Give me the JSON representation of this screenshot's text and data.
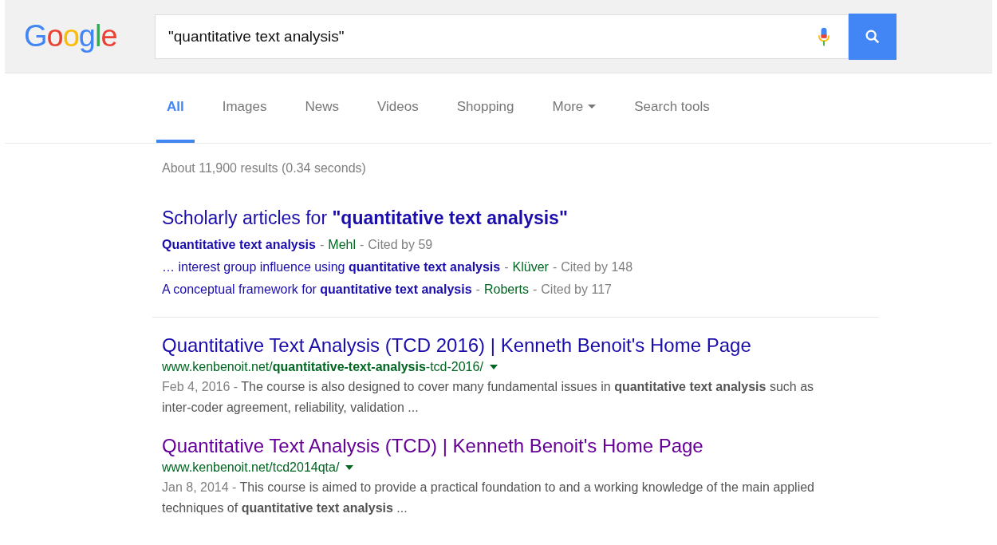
{
  "logo": [
    {
      "char": "G",
      "color": "#4285f4"
    },
    {
      "char": "o",
      "color": "#ea4335"
    },
    {
      "char": "o",
      "color": "#fbbc05"
    },
    {
      "char": "g",
      "color": "#4285f4"
    },
    {
      "char": "l",
      "color": "#34a853"
    },
    {
      "char": "e",
      "color": "#ea4335"
    }
  ],
  "search": {
    "value": "\"quantitative text analysis\""
  },
  "tabs": [
    {
      "label": "All",
      "selected": true,
      "dropdown": false
    },
    {
      "label": "Images",
      "selected": false,
      "dropdown": false
    },
    {
      "label": "News",
      "selected": false,
      "dropdown": false
    },
    {
      "label": "Videos",
      "selected": false,
      "dropdown": false
    },
    {
      "label": "Shopping",
      "selected": false,
      "dropdown": false
    },
    {
      "label": "More",
      "selected": false,
      "dropdown": true
    },
    {
      "label": "Search tools",
      "selected": false,
      "dropdown": false
    }
  ],
  "result_stats": "About 11,900 results (0.34 seconds)",
  "scholarly": {
    "heading": "Scholarly articles for **\"quantitative text analysis\"**",
    "items": [
      {
        "title": "**Quantitative text analysis**",
        "separators": [
          "-",
          "-"
        ],
        "author": "Mehl",
        "cited": "Cited by 59"
      },
      {
        "title": "… interest group influence using **quantitative text analysis**",
        "separators": [
          "-",
          "-"
        ],
        "author": "Klüver",
        "cited": "Cited by 148"
      },
      {
        "title": "A conceptual framework for **quantitative text analysis**",
        "separators": [
          "-",
          "-"
        ],
        "author": "Roberts",
        "cited": "Cited by 117"
      }
    ]
  },
  "results": [
    {
      "title": "Quantitative Text Analysis (TCD 2016) | Kenneth Benoit's Home Page",
      "visited": false,
      "url": "www.kenbenoit.net/**quantitative-text-analysis**-tcd-2016/",
      "date": "Feb 4, 2016 -",
      "snippet": "The course is also designed to cover many fundamental issues in **quantitative text analysis** such as inter-coder agreement, reliability, validation ..."
    },
    {
      "title": "Quantitative Text Analysis (TCD) | Kenneth Benoit's Home Page",
      "visited": true,
      "url": "www.kenbenoit.net/tcd2014qta/",
      "date": "Jan 8, 2014 -",
      "snippet": "This course is aimed to provide a practical foundation to and a working knowledge of the main applied techniques of **quantitative text analysis** ..."
    }
  ]
}
